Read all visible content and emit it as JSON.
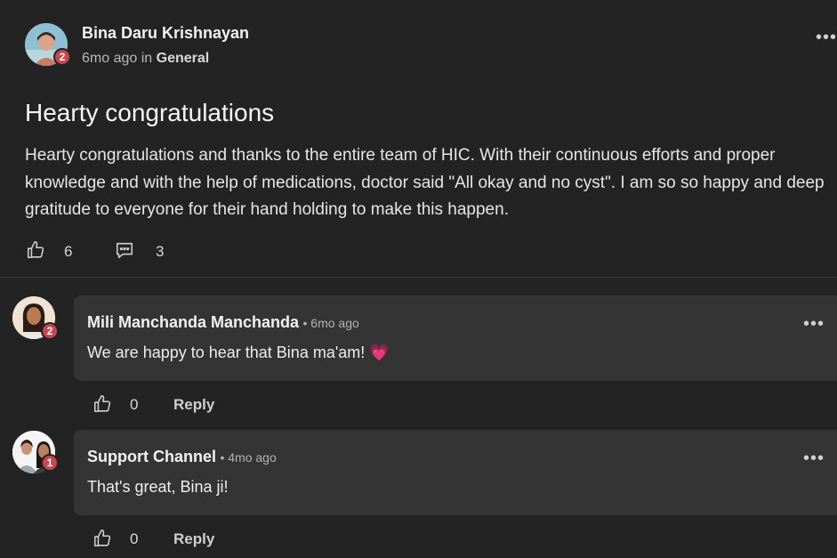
{
  "post": {
    "author": "Bina Daru Krishnayan",
    "badge": "2",
    "time": "6mo ago",
    "in_word": "in",
    "channel": "General",
    "title": "Hearty congratulations",
    "body": "Hearty congratulations and thanks to the entire team of HIC. With their continuous efforts and proper knowledge and with the help of medications, doctor said \"All okay and no cyst\". I am so so happy and deep gratitude to everyone for their hand holding to make this happen.",
    "likes": "6",
    "comments": "3",
    "more": "•••"
  },
  "comments": [
    {
      "author": "Mili Manchanda Manchanda",
      "time": "6mo ago",
      "badge": "2",
      "text": "We are happy to hear that Bina ma'am!",
      "emoji": "💗",
      "likes": "0",
      "reply": "Reply",
      "more": "•••"
    },
    {
      "author": "Support Channel",
      "time": "4mo ago",
      "badge": "1",
      "text": "That's great, Bina ji!",
      "likes": "0",
      "reply": "Reply",
      "more": "•••"
    }
  ],
  "colors": {
    "background": "#232323",
    "comment_bg": "#343434",
    "badge": "#c8464f"
  },
  "icons": [
    "thumbs-up-icon",
    "comment-icon",
    "more-icon"
  ]
}
